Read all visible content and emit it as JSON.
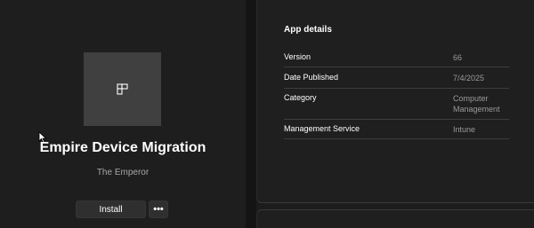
{
  "app": {
    "title": "Empire Device Migration",
    "publisher": "The Emperor",
    "icon": "app-grid-icon"
  },
  "actions": {
    "install_label": "Install",
    "more_label": "•••"
  },
  "details": {
    "heading": "App details",
    "rows": [
      {
        "label": "Version",
        "value": "66"
      },
      {
        "label": "Date Published",
        "value": "7/4/2025"
      },
      {
        "label": "Category",
        "value": "Computer Management"
      },
      {
        "label": "Management Service",
        "value": "Intune"
      }
    ]
  },
  "colors": {
    "background": "#1c1c1c",
    "tile": "#404040",
    "button": "#2f2f2f",
    "muted_text": "#9a9a9a"
  }
}
